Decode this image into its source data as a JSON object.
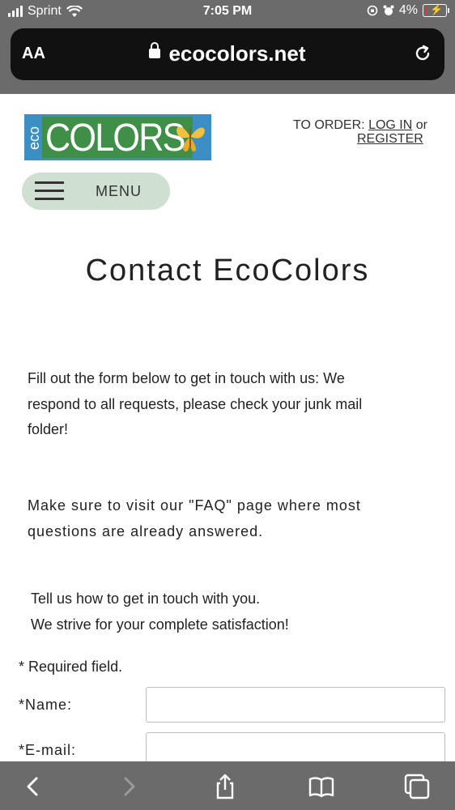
{
  "status_bar": {
    "carrier": "Sprint",
    "time": "7:05 PM",
    "battery": "4%"
  },
  "browser": {
    "aa_label": "AA",
    "url": "ecocolors.net"
  },
  "header": {
    "logo_prefix": "eco",
    "logo_text": "COLORS",
    "order_prefix": "TO ORDER:",
    "login_label": "LOG IN",
    "or_label": "or",
    "register_label": "REGISTER",
    "menu_label": "MENU"
  },
  "page": {
    "title": "Contact EcoColors",
    "intro_line1": "Fill out the form below to get in touch with us: We",
    "intro_line2": "respond to all requests, please check your junk mail",
    "intro_line3": "folder!",
    "faq_line1": "Make sure to visit our \"FAQ\" page where most",
    "faq_line2": "questions are already answered.",
    "tell_line1": "Tell us how to get in touch with you.",
    "tell_line2": "We strive for your complete satisfaction!"
  },
  "form": {
    "required_note": "* Required field.",
    "name_label": "*Name:",
    "email_label": "*E-mail:",
    "name_value": "",
    "email_value": ""
  },
  "toolbar_icons": [
    "back-icon",
    "forward-icon",
    "share-icon",
    "bookmarks-icon",
    "tabs-icon"
  ]
}
